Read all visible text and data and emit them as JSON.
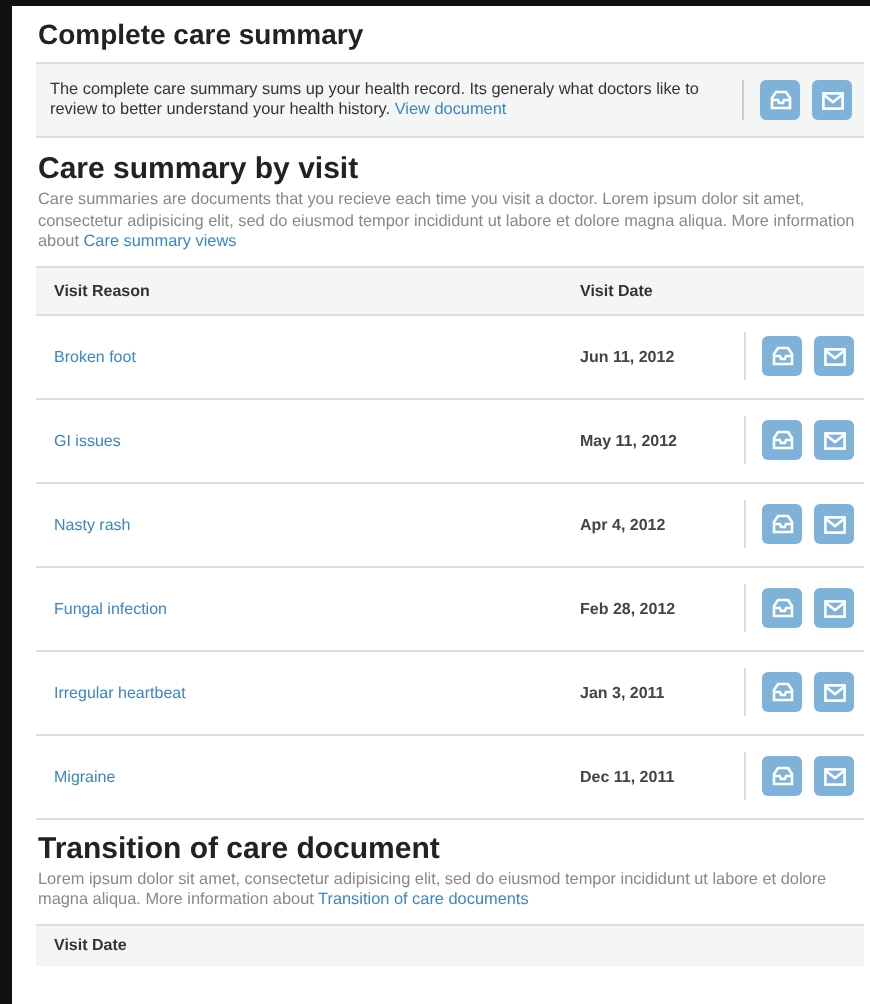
{
  "complete_summary": {
    "title": "Complete care summary",
    "text": "The complete care summary sums up your health record.  Its generaly what doctors like to review to better understand your health history.",
    "link": "View document"
  },
  "by_visit": {
    "title": "Care summary by visit",
    "text": "Care summaries are documents that you recieve each time you visit a doctor. Lorem ipsum dolor sit amet, consectetur adipisicing elit, sed do eiusmod tempor incididunt ut labore et dolore magna aliqua.  More information about",
    "link": "Care summary views",
    "columns": [
      "Visit Reason",
      "Visit Date"
    ],
    "rows": [
      {
        "reason": "Broken foot",
        "date": "Jun 11, 2012"
      },
      {
        "reason": "GI issues",
        "date": "May 11, 2012"
      },
      {
        "reason": "Nasty rash",
        "date": "Apr 4, 2012"
      },
      {
        "reason": "Fungal infection",
        "date": "Feb 28, 2012"
      },
      {
        "reason": "Irregular heartbeat",
        "date": "Jan 3, 2011"
      },
      {
        "reason": "Migraine",
        "date": "Dec 11, 2011"
      }
    ]
  },
  "transition": {
    "title": "Transition of care document",
    "text": "Lorem ipsum dolor sit amet, consectetur adipisicing elit, sed do eiusmod tempor incididunt ut labore et dolore magna aliqua.  More information about",
    "link": "Transition of care documents",
    "columns": [
      "Visit Date"
    ]
  }
}
